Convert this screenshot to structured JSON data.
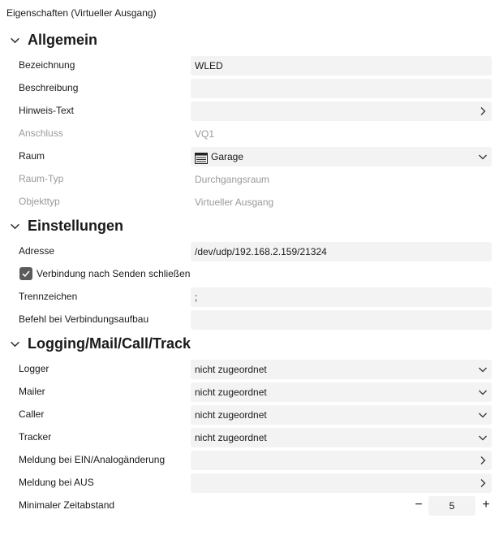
{
  "window": {
    "title": "Eigenschaften (Virtueller Ausgang)"
  },
  "sections": {
    "allgemein": "Allgemein",
    "einstellungen": "Einstellungen",
    "logging": "Logging/Mail/Call/Track"
  },
  "allgemein": {
    "bezeichnung": {
      "label": "Bezeichnung",
      "value": "WLED"
    },
    "beschreibung": {
      "label": "Beschreibung",
      "value": ""
    },
    "hinweis": {
      "label": "Hinweis-Text",
      "value": ""
    },
    "anschluss": {
      "label": "Anschluss",
      "value": "VQ1"
    },
    "raum": {
      "label": "Raum",
      "value": "Garage",
      "icon": "room-icon"
    },
    "raum_typ": {
      "label": "Raum-Typ",
      "value": "Durchgangsraum"
    },
    "objekttyp": {
      "label": "Objekttyp",
      "value": "Virtueller Ausgang"
    }
  },
  "einstellungen": {
    "adresse": {
      "label": "Adresse",
      "value": "/dev/udp/192.168.2.159/21324"
    },
    "verbindung": {
      "label": "Verbindung nach Senden schließen",
      "checked": true
    },
    "trennzeichen": {
      "label": "Trennzeichen",
      "value": ";"
    },
    "befehl": {
      "label": "Befehl bei Verbindungsaufbau",
      "value": ""
    }
  },
  "logging": {
    "logger": {
      "label": "Logger",
      "value": "nicht zugeordnet"
    },
    "mailer": {
      "label": "Mailer",
      "value": "nicht zugeordnet"
    },
    "caller": {
      "label": "Caller",
      "value": "nicht zugeordnet"
    },
    "tracker": {
      "label": "Tracker",
      "value": "nicht zugeordnet"
    },
    "meldung_ein": {
      "label": "Meldung bei EIN/Analogänderung",
      "value": ""
    },
    "meldung_aus": {
      "label": "Meldung bei AUS",
      "value": ""
    },
    "zeitabstand": {
      "label": "Minimaler Zeitabstand",
      "value": "5",
      "minus": "−",
      "plus": "+"
    }
  }
}
